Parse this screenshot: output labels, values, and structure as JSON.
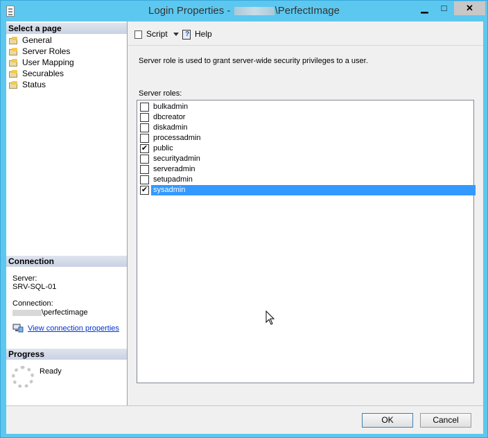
{
  "window": {
    "title_prefix": "Login Properties - ",
    "title_suffix": "\\PerfectImage",
    "min_glyph": "▁",
    "max_glyph": "□",
    "close_glyph": "✕"
  },
  "left_pane": {
    "select_page_header": "Select a page",
    "pages": [
      {
        "label": "General"
      },
      {
        "label": "Server Roles"
      },
      {
        "label": "User Mapping"
      },
      {
        "label": "Securables"
      },
      {
        "label": "Status"
      }
    ],
    "connection_header": "Connection",
    "server_label": "Server:",
    "server_value": "SRV-SQL-01",
    "connection_label": "Connection:",
    "connection_value": "\\perfectimage",
    "view_connection_link": "View connection properties",
    "progress_header": "Progress",
    "progress_status": "Ready"
  },
  "toolbar": {
    "script_label": "Script",
    "help_label": "Help"
  },
  "content": {
    "description": "Server role is used to grant server-wide security privileges to a user.",
    "roles_label": "Server roles:",
    "roles": [
      {
        "name": "bulkadmin",
        "checked": false
      },
      {
        "name": "dbcreator",
        "checked": false
      },
      {
        "name": "diskadmin",
        "checked": false
      },
      {
        "name": "processadmin",
        "checked": false
      },
      {
        "name": "public",
        "checked": true
      },
      {
        "name": "securityadmin",
        "checked": false
      },
      {
        "name": "serveradmin",
        "checked": false
      },
      {
        "name": "setupadmin",
        "checked": false
      },
      {
        "name": "sysadmin",
        "checked": true,
        "selected": true
      }
    ],
    "check_glyph": "✔"
  },
  "footer": {
    "ok_label": "OK",
    "cancel_label": "Cancel"
  }
}
